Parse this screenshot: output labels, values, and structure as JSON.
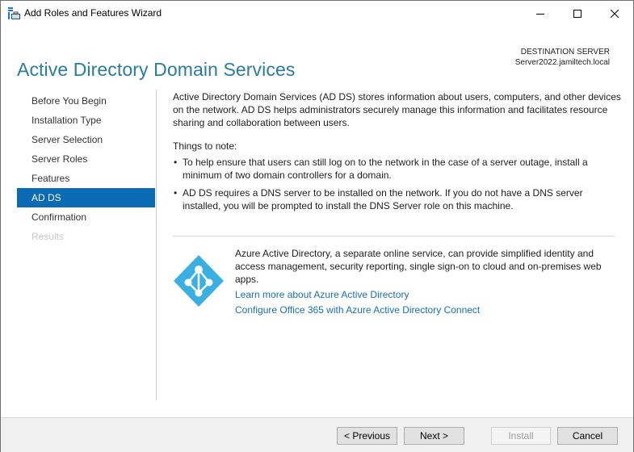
{
  "window": {
    "title": "Add Roles and Features Wizard",
    "icon": "server-manager-icon",
    "controls": [
      "minimize-icon",
      "maximize-icon",
      "close-icon"
    ]
  },
  "header": {
    "page_title": "Active Directory Domain Services",
    "destination_label": "DESTINATION SERVER",
    "destination_server": "Server2022.jamiltech.local"
  },
  "nav": {
    "items": [
      {
        "label": "Before You Begin",
        "state": "normal"
      },
      {
        "label": "Installation Type",
        "state": "normal"
      },
      {
        "label": "Server Selection",
        "state": "normal"
      },
      {
        "label": "Server Roles",
        "state": "normal"
      },
      {
        "label": "Features",
        "state": "normal"
      },
      {
        "label": "AD DS",
        "state": "active"
      },
      {
        "label": "Confirmation",
        "state": "normal"
      },
      {
        "label": "Results",
        "state": "disabled"
      }
    ]
  },
  "content": {
    "intro": "Active Directory Domain Services (AD DS) stores information about users, computers, and other devices on the network.  AD DS helps administrators securely manage this information and facilitates resource sharing and collaboration between users.",
    "notes_heading": "Things to note:",
    "bullet_char": "•",
    "notes": [
      "To help ensure that users can still log on to the network in the case of a server outage, install a minimum of two domain controllers for a domain.",
      "AD DS requires a DNS server to be installed on the network.  If you do not have a DNS server installed, you will be prompted to install the DNS Server role on this machine."
    ]
  },
  "azure": {
    "icon": "azure-active-directory-icon",
    "description": "Azure Active Directory, a separate online service, can provide simplified identity and access management, security reporting, single sign-on to cloud and on-premises web apps.",
    "links": [
      "Learn more about Azure Active Directory",
      "Configure Office 365 with Azure Active Directory Connect"
    ]
  },
  "footer": {
    "previous_label": "< Previous",
    "next_label": "Next >",
    "install_label": "Install",
    "cancel_label": "Cancel"
  },
  "colors": {
    "title": "#2b7c9e",
    "nav_active_bg": "#0a6ab4",
    "link": "#1a6fb5",
    "azure_icon": "#3ab0e2"
  }
}
